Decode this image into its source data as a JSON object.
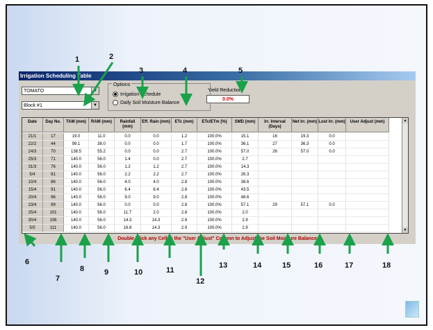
{
  "window": {
    "title": "Irrigation Scheduling Table",
    "crop_select": "TOMATO",
    "block_select": "Block #1",
    "options_title": "Options",
    "options": [
      {
        "label": "Irrigation Schedule",
        "selected": true
      },
      {
        "label": "Daily Soil Moisture Balance",
        "selected": false
      }
    ],
    "yield_label": "Yield Reduction",
    "yield_value": "0.0%",
    "hint": "Double Click any Cell in the \"User Adjust\" Column to Adjust the Soil Moisture Balance"
  },
  "table": {
    "headers": [
      "Date",
      "Day No.",
      "TAM (mm)",
      "RAM (mm)",
      "Rainfall (mm)",
      "Eff. Rain (mm)",
      "ETc (mm)",
      "ETc/ETm (%)",
      "SMD (mm)",
      "Irr. Interval (Days)",
      "Net Irr. (mm)",
      "Lost Irr. (mm)",
      "User Adjust (mm)"
    ],
    "rows": [
      [
        "21/1",
        "17",
        "19.0",
        "11.0",
        "0.0",
        "0.0",
        "1.2",
        "100.0%",
        "15.1",
        "16",
        "19.3",
        "0.0",
        ""
      ],
      [
        "22/2",
        "44",
        "99.1",
        "38.0",
        "0.0",
        "0.0",
        "1.7",
        "100.0%",
        "36.1",
        "27",
        "36.3",
        "0.0",
        ""
      ],
      [
        "24/3",
        "70",
        "138.5",
        "55.2",
        "0.0",
        "0.0",
        "2.7",
        "100.0%",
        "57.0",
        "26",
        "57.0",
        "0.0",
        ""
      ],
      [
        "25/3",
        "71",
        "140.0",
        "56.0",
        "1.4",
        "0.0",
        "2.7",
        "100.0%",
        "2.7",
        "",
        "",
        "",
        ""
      ],
      [
        "31/3",
        "76",
        "140.0",
        "56.0",
        "1.2",
        "1.2",
        "2.7",
        "100.0%",
        "14.3",
        "",
        "",
        "",
        ""
      ],
      [
        "5/4",
        "81",
        "140.0",
        "56.0",
        "2.2",
        "2.2",
        "2.7",
        "100.0%",
        "26.3",
        "",
        "",
        "",
        ""
      ],
      [
        "10/4",
        "86",
        "140.0",
        "56.0",
        "4.0",
        "4.0",
        "2.8",
        "100.0%",
        "38.6",
        "",
        "",
        "",
        ""
      ],
      [
        "15/4",
        "91",
        "140.0",
        "56.0",
        "6.4",
        "6.4",
        "2.8",
        "100.0%",
        "43.5",
        "",
        "",
        "",
        ""
      ],
      [
        "20/4",
        "96",
        "140.0",
        "56.0",
        "9.0",
        "9.0",
        "2.8",
        "100.0%",
        "48.6",
        "",
        "",
        "",
        ""
      ],
      [
        "23/4",
        "99",
        "140.0",
        "56.0",
        "0.0",
        "0.0",
        "2.8",
        "100.0%",
        "57.1",
        "29",
        "57.1",
        "0.0",
        ""
      ],
      [
        "25/4",
        "101",
        "140.0",
        "56.0",
        "11.7",
        "2.0",
        "2.8",
        "100.0%",
        "2.0",
        "",
        "",
        "",
        ""
      ],
      [
        "30/4",
        "106",
        "140.0",
        "56.0",
        "14.3",
        "14.3",
        "2.9",
        "100.0%",
        "2.9",
        "",
        "",
        "",
        ""
      ],
      [
        "5/5",
        "111",
        "140.0",
        "56.0",
        "16.8",
        "14.3",
        "2.9",
        "100.0%",
        "2.9",
        "",
        "",
        "",
        ""
      ]
    ]
  },
  "callouts": [
    "1",
    "2",
    "3",
    "4",
    "5",
    "6",
    "7",
    "8",
    "9",
    "10",
    "11",
    "12",
    "13",
    "14",
    "15",
    "16",
    "17",
    "18"
  ],
  "colors": {
    "arrow": "#1aa14a",
    "hint": "#b00000",
    "title_start": "#0a246a"
  }
}
